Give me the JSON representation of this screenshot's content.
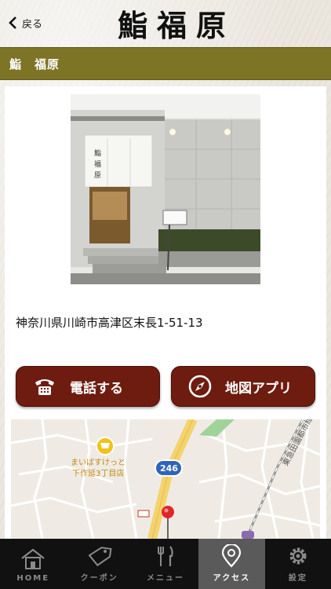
{
  "header": {
    "back_label": "戻る",
    "logo": [
      "鮨",
      "福",
      "原"
    ]
  },
  "titlebar": {
    "title": "鮨　福原"
  },
  "shop": {
    "address": "神奈川県川崎市高津区末長1-51-13"
  },
  "actions": {
    "call_label": "電話する",
    "map_label": "地図アプリ"
  },
  "map": {
    "poi_name_line1": "まいばすけっと",
    "poi_name_line2": "下作延3丁目店",
    "route_number": "246",
    "rail_label": "東急田園都市線"
  },
  "tabs": [
    {
      "label": "HOME",
      "icon": "home-icon",
      "active": false
    },
    {
      "label": "クーポン",
      "icon": "coupon-icon",
      "active": false
    },
    {
      "label": "メニュー",
      "icon": "menu-icon",
      "active": false
    },
    {
      "label": "アクセス",
      "icon": "location-pin-icon",
      "active": true
    },
    {
      "label": "設定",
      "icon": "gear-icon",
      "active": false
    }
  ],
  "colors": {
    "titlebar": "#7d7426",
    "button": "#6e1c10",
    "tabbar": "#111111"
  }
}
